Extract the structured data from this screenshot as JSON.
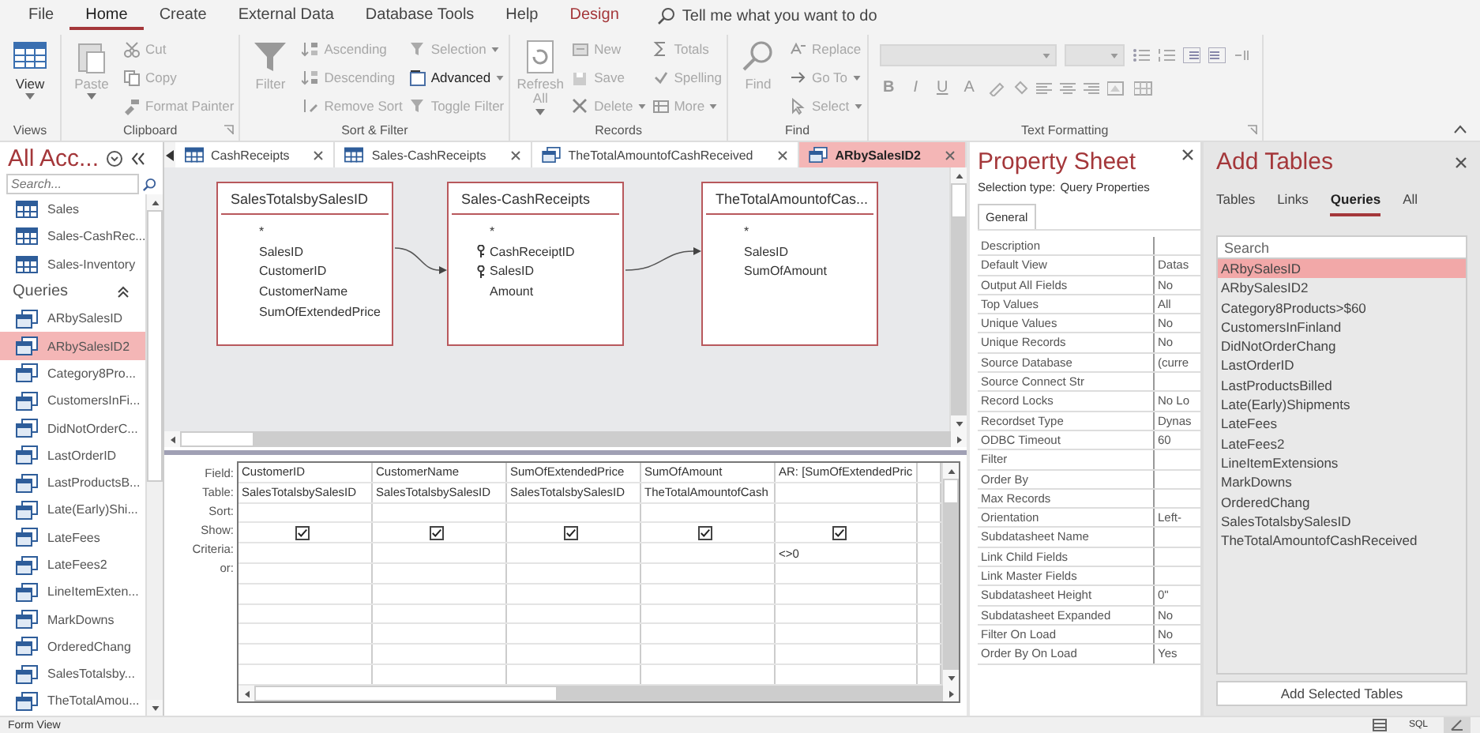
{
  "menu": [
    {
      "label": "File",
      "kind": "tab",
      "selected": false
    },
    {
      "label": "Home",
      "kind": "tab",
      "selected": true
    },
    {
      "label": "Create",
      "kind": "tab",
      "selected": false
    },
    {
      "label": "External Data",
      "kind": "tab",
      "selected": false
    },
    {
      "label": "Database Tools",
      "kind": "tab",
      "selected": false
    },
    {
      "label": "Help",
      "kind": "tab",
      "selected": false
    },
    {
      "label": "Design",
      "kind": "contextual",
      "selected": false
    }
  ],
  "tell_me": {
    "placeholder": "Tell me what you want to do"
  },
  "ribbon": {
    "groups": [
      {
        "label": "Views",
        "launcher": false,
        "columns": [
          {
            "kind": "large",
            "label": "View",
            "disabled": false,
            "dropdown": true
          }
        ]
      },
      {
        "label": "Clipboard",
        "launcher": true,
        "columns": [
          {
            "kind": "large",
            "label": "Paste",
            "disabled": true,
            "dropdown": true
          },
          {
            "kind": "stack",
            "items": [
              {
                "label": "Cut",
                "disabled": true,
                "dropdown": false
              },
              {
                "label": "Copy",
                "disabled": true,
                "dropdown": false
              },
              {
                "label": "Format Painter",
                "disabled": true,
                "dropdown": false
              }
            ]
          }
        ]
      },
      {
        "label": "Sort & Filter",
        "launcher": false,
        "columns": [
          {
            "kind": "large",
            "label": "Filter",
            "disabled": true,
            "dropdown": false
          },
          {
            "kind": "stack",
            "items": [
              {
                "label": "Ascending",
                "disabled": true,
                "dropdown": false
              },
              {
                "label": "Descending",
                "disabled": true,
                "dropdown": false
              },
              {
                "label": "Remove Sort",
                "disabled": true,
                "dropdown": false
              }
            ]
          },
          {
            "kind": "stack",
            "items": [
              {
                "label": "Selection",
                "disabled": true,
                "dropdown": true
              },
              {
                "label": "Advanced",
                "disabled": false,
                "dropdown": true
              },
              {
                "label": "Toggle Filter",
                "disabled": true,
                "dropdown": false
              }
            ]
          }
        ]
      },
      {
        "label": "Records",
        "launcher": false,
        "columns": [
          {
            "kind": "large",
            "label": "Refresh All",
            "disabled": true,
            "dropdown": true
          },
          {
            "kind": "stack",
            "items": [
              {
                "label": "New",
                "disabled": true,
                "dropdown": false
              },
              {
                "label": "Save",
                "disabled": true,
                "dropdown": false
              },
              {
                "label": "Delete",
                "disabled": true,
                "dropdown": true
              }
            ]
          },
          {
            "kind": "stack",
            "items": [
              {
                "label": "Totals",
                "disabled": true,
                "dropdown": false
              },
              {
                "label": "Spelling",
                "disabled": true,
                "dropdown": false
              },
              {
                "label": "More",
                "disabled": true,
                "dropdown": true
              }
            ]
          }
        ]
      },
      {
        "label": "Find",
        "launcher": false,
        "columns": [
          {
            "kind": "large",
            "label": "Find",
            "disabled": true,
            "dropdown": false
          },
          {
            "kind": "stack",
            "items": [
              {
                "label": "Replace",
                "disabled": true,
                "dropdown": false
              },
              {
                "label": "Go To",
                "disabled": true,
                "dropdown": true
              },
              {
                "label": "Select",
                "disabled": true,
                "dropdown": true
              }
            ]
          }
        ]
      },
      {
        "label": "Text Formatting",
        "launcher": true,
        "columns": [
          {
            "kind": "format",
            "disabled": true,
            "buttons": [
              "B",
              "I",
              "U",
              "A"
            ]
          }
        ]
      }
    ]
  },
  "nav": {
    "title": "All Acc...",
    "search": {
      "placeholder": "Search..."
    },
    "items": [
      {
        "kind": "table",
        "label": "Sales",
        "selected": false
      },
      {
        "kind": "table",
        "label": "Sales-CashRec...",
        "selected": false
      },
      {
        "kind": "table",
        "label": "Sales-Inventory",
        "selected": false
      },
      {
        "kind": "header",
        "label": "Queries",
        "expanded": true
      },
      {
        "kind": "query",
        "label": "ARbySalesID",
        "selected": false
      },
      {
        "kind": "query",
        "label": "ARbySalesID2",
        "selected": true
      },
      {
        "kind": "query",
        "label": "Category8Pro...",
        "selected": false
      },
      {
        "kind": "query",
        "label": "CustomersInFi...",
        "selected": false
      },
      {
        "kind": "query",
        "label": "DidNotOrderC...",
        "selected": false
      },
      {
        "kind": "query",
        "label": "LastOrderID",
        "selected": false
      },
      {
        "kind": "query",
        "label": "LastProductsB...",
        "selected": false
      },
      {
        "kind": "query",
        "label": "Late(Early)Shi...",
        "selected": false
      },
      {
        "kind": "query",
        "label": "LateFees",
        "selected": false
      },
      {
        "kind": "query",
        "label": "LateFees2",
        "selected": false
      },
      {
        "kind": "query",
        "label": "LineItemExten...",
        "selected": false
      },
      {
        "kind": "query",
        "label": "MarkDowns",
        "selected": false
      },
      {
        "kind": "query",
        "label": "OrderedChang",
        "selected": false
      },
      {
        "kind": "query",
        "label": "SalesTotalsby...",
        "selected": false
      },
      {
        "kind": "query",
        "label": "TheTotalAmou...",
        "selected": false
      }
    ]
  },
  "doc_tabs": [
    {
      "label": "CashReceipts",
      "kind": "table",
      "selected": false
    },
    {
      "label": "Sales-CashReceipts",
      "kind": "table",
      "selected": false
    },
    {
      "label": "TheTotalAmountofCashReceived",
      "kind": "query",
      "selected": false
    },
    {
      "label": "ARbySalesID2",
      "kind": "query",
      "selected": true
    }
  ],
  "design_tables": [
    {
      "name": "SalesTotalsbySalesID",
      "joined_to_next": true,
      "fields": [
        {
          "name": "*",
          "key": false
        },
        {
          "name": "SalesID",
          "key": false
        },
        {
          "name": "CustomerID",
          "key": false
        },
        {
          "name": "CustomerName",
          "key": false
        },
        {
          "name": "SumOfExtendedPrice",
          "key": false
        }
      ]
    },
    {
      "name": "Sales-CashReceipts",
      "joined_to_next": true,
      "fields": [
        {
          "name": "*",
          "key": false
        },
        {
          "name": "CashReceiptID",
          "key": true
        },
        {
          "name": "SalesID",
          "key": true
        },
        {
          "name": "Amount",
          "key": false
        }
      ]
    },
    {
      "name": "TheTotalAmountofCas...",
      "joined_to_next": false,
      "fields": [
        {
          "name": "*",
          "key": false
        },
        {
          "name": "SalesID",
          "key": false
        },
        {
          "name": "SumOfAmount",
          "key": false
        }
      ]
    }
  ],
  "grid": {
    "labels": [
      "Field:",
      "Table:",
      "Sort:",
      "Show:",
      "Criteria:",
      "or:"
    ],
    "columns": [
      {
        "field": "CustomerID",
        "table": "SalesTotalsbySalesID",
        "show": true
      },
      {
        "field": "CustomerName",
        "table": "SalesTotalsbySalesID",
        "show": true
      },
      {
        "field": "SumOfExtendedPrice",
        "table": "SalesTotalsbySalesID",
        "show": true
      },
      {
        "field": "SumOfAmount",
        "table": "TheTotalAmountofCash",
        "show": true
      },
      {
        "field": "AR: [SumOfExtendedPric",
        "show": true,
        "criteria": "<>0"
      }
    ]
  },
  "property_sheet": {
    "title": "Property Sheet",
    "selection_type_label": "Selection type:",
    "selection_type": "Query Properties",
    "tabs": [
      {
        "label": "General",
        "selected": true
      }
    ],
    "rows": [
      {
        "name": "Description"
      },
      {
        "name": "Default View",
        "value": "Datas"
      },
      {
        "name": "Output All Fields",
        "value": "No"
      },
      {
        "name": "Top Values",
        "value": "All"
      },
      {
        "name": "Unique Values",
        "value": "No"
      },
      {
        "name": "Unique Records",
        "value": "No"
      },
      {
        "name": "Source Database",
        "value": "(curre"
      },
      {
        "name": "Source Connect Str"
      },
      {
        "name": "Record Locks",
        "value": "No Lo"
      },
      {
        "name": "Recordset Type",
        "value": "Dynas"
      },
      {
        "name": "ODBC Timeout",
        "value": "60"
      },
      {
        "name": "Filter"
      },
      {
        "name": "Order By"
      },
      {
        "name": "Max Records"
      },
      {
        "name": "Orientation",
        "value": "Left-"
      },
      {
        "name": "Subdatasheet Name"
      },
      {
        "name": "Link Child Fields"
      },
      {
        "name": "Link Master Fields"
      },
      {
        "name": "Subdatasheet Height",
        "value": "0\""
      },
      {
        "name": "Subdatasheet Expanded",
        "value": "No"
      },
      {
        "name": "Filter On Load",
        "value": "No"
      },
      {
        "name": "Order By On Load",
        "value": "Yes"
      }
    ]
  },
  "add_tables": {
    "title": "Add Tables",
    "tabs": [
      {
        "label": "Tables",
        "selected": false
      },
      {
        "label": "Links",
        "selected": false
      },
      {
        "label": "Queries",
        "selected": true
      },
      {
        "label": "All",
        "selected": false
      }
    ],
    "search": {
      "placeholder": "Search"
    },
    "items": [
      {
        "label": "ARbySalesID",
        "selected": true
      },
      {
        "label": "ARbySalesID2",
        "selected": false
      },
      {
        "label": "Category8Products>$60",
        "selected": false
      },
      {
        "label": "CustomersInFinland",
        "selected": false
      },
      {
        "label": "DidNotOrderChang",
        "selected": false
      },
      {
        "label": "LastOrderID",
        "selected": false
      },
      {
        "label": "LastProductsBilled",
        "selected": false
      },
      {
        "label": "Late(Early)Shipments",
        "selected": false
      },
      {
        "label": "LateFees",
        "selected": false
      },
      {
        "label": "LateFees2",
        "selected": false
      },
      {
        "label": "LineItemExtensions",
        "selected": false
      },
      {
        "label": "MarkDowns",
        "selected": false
      },
      {
        "label": "OrderedChang",
        "selected": false
      },
      {
        "label": "SalesTotalsbySalesID",
        "selected": false
      },
      {
        "label": "TheTotalAmountofCashReceived",
        "selected": false
      }
    ],
    "button": "Add Selected Tables"
  },
  "status_bar": {
    "text": "Form View",
    "views": [
      {
        "kind": "datasheet",
        "selected": false
      },
      {
        "kind": "sql",
        "label": "SQL",
        "selected": false
      },
      {
        "kind": "design",
        "selected": true
      }
    ]
  }
}
